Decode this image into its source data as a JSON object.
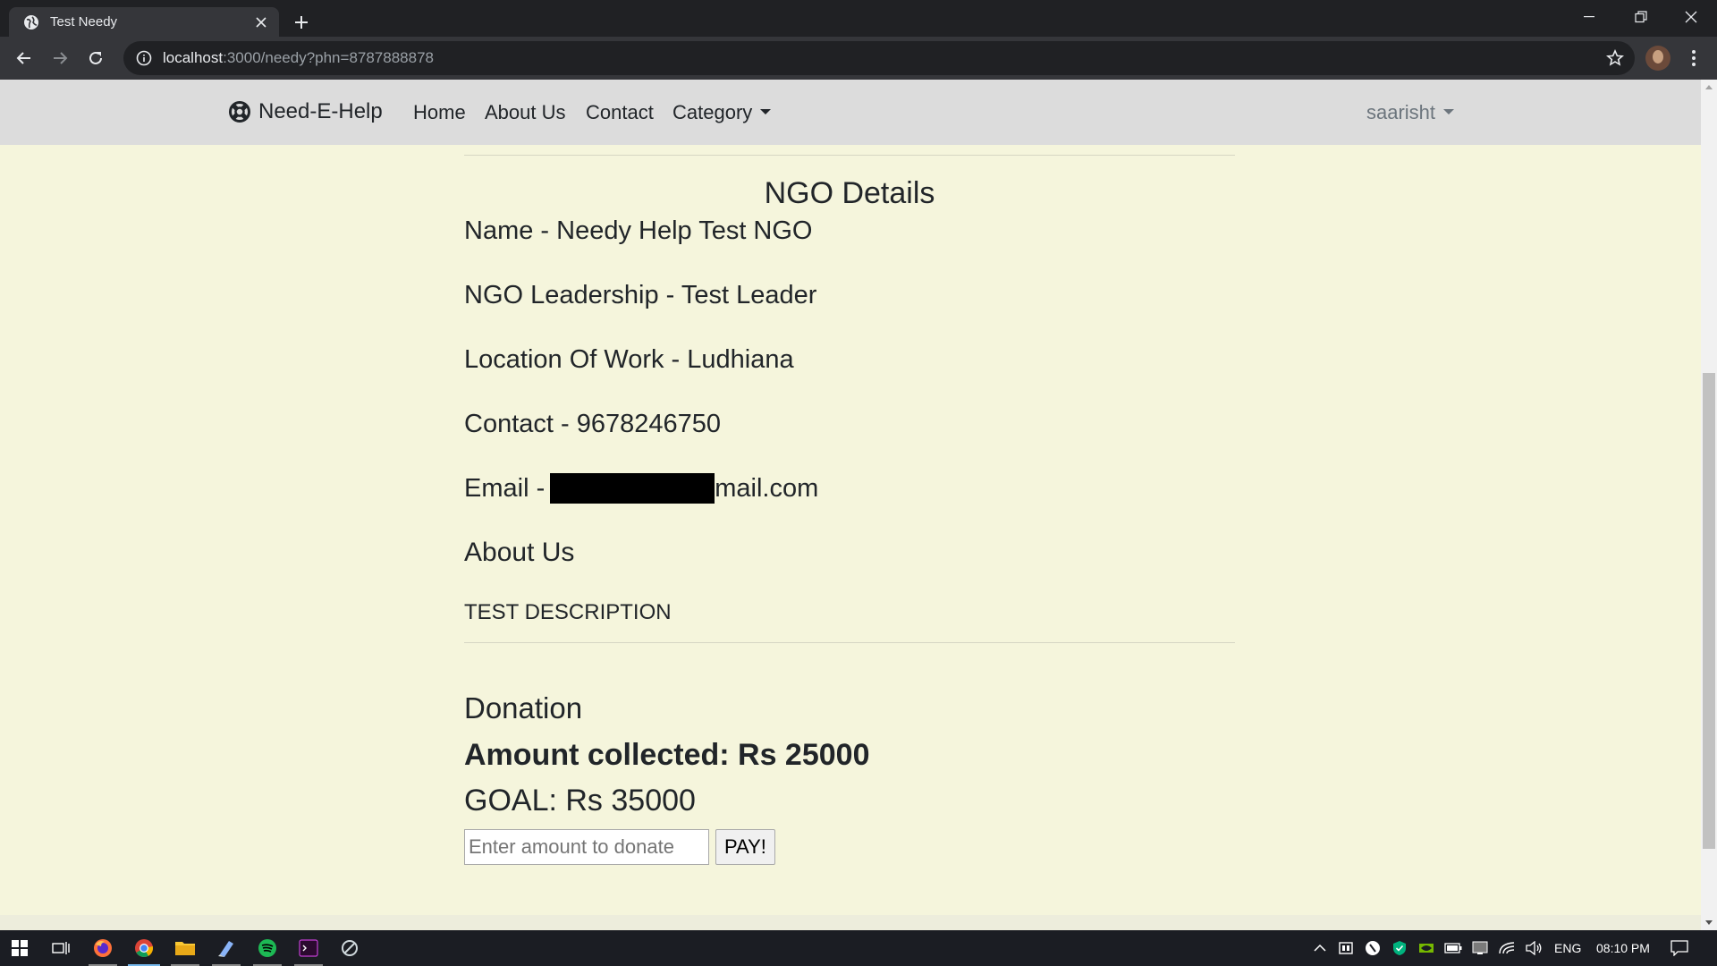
{
  "browser": {
    "tab_title": "Test Needy",
    "url_host": "localhost",
    "url_path": ":3000/needy?phn=8787888878"
  },
  "navbar": {
    "brand": "Need-E-Help",
    "links": [
      "Home",
      "About Us",
      "Contact"
    ],
    "category_label": "Category",
    "user_label": "saarisht"
  },
  "ngo": {
    "heading": "NGO Details",
    "name_line": "Name - Needy Help Test NGO",
    "leadership_line": "NGO Leadership - Test Leader",
    "location_line": "Location Of Work - Ludhiana",
    "contact_line": "Contact - 9678246750",
    "email_prefix": "Email -",
    "email_suffix": "mail.com",
    "about_heading": "About Us",
    "about_text": "TEST DESCRIPTION"
  },
  "donation": {
    "heading": "Donation",
    "amount_collected": "Amount collected: Rs 25000",
    "goal": "GOAL: Rs 35000",
    "input_placeholder": "Enter amount to donate",
    "pay_label": "PAY!"
  },
  "taskbar": {
    "language": "ENG",
    "time": "08:10 PM"
  },
  "colors": {
    "page_background": "#f5f5dc",
    "navbar_background": "#dcdcdc",
    "text": "#212529",
    "muted_text": "#6c757d"
  }
}
